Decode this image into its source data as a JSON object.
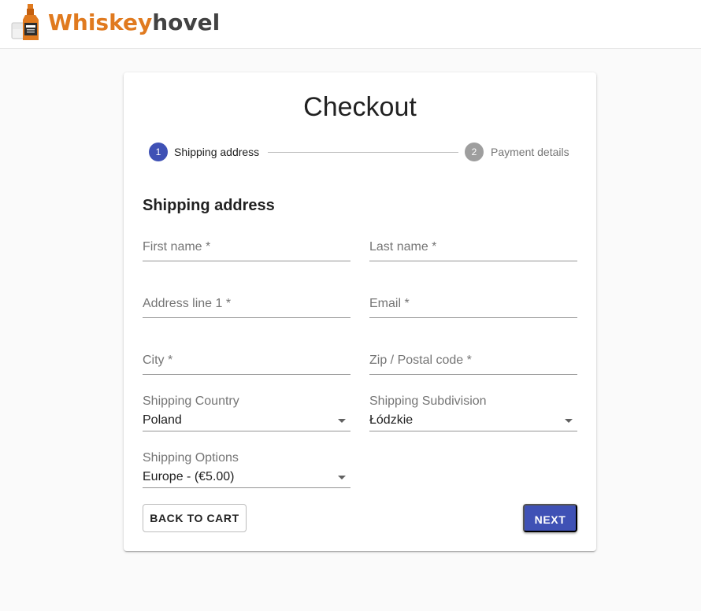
{
  "header": {
    "brand_part1": "Whiskey",
    "brand_part2": "hovel",
    "logo_icon": "whiskey-bottle-and-glass"
  },
  "checkout": {
    "title": "Checkout",
    "steps": [
      {
        "number": "1",
        "label": "Shipping address",
        "state": "active"
      },
      {
        "number": "2",
        "label": "Payment details",
        "state": "inactive"
      }
    ],
    "section_title": "Shipping address",
    "fields": {
      "first_name": {
        "placeholder": "First name *"
      },
      "last_name": {
        "placeholder": "Last name *"
      },
      "address_line1": {
        "placeholder": "Address line 1 *"
      },
      "email": {
        "placeholder": "Email *"
      },
      "city": {
        "placeholder": "City *"
      },
      "zip": {
        "placeholder": "Zip / Postal code *"
      },
      "shipping_country": {
        "label": "Shipping Country",
        "value": "Poland"
      },
      "shipping_subdivision": {
        "label": "Shipping Subdivision",
        "value": "Łódzkie"
      },
      "shipping_options": {
        "label": "Shipping Options",
        "value": "Europe - (€5.00)"
      }
    },
    "buttons": {
      "back": "BACK TO CART",
      "next": "NEXT"
    }
  },
  "colors": {
    "primary": "#3f51b5",
    "brand_orange": "#e07a1f",
    "brand_gray": "#424242",
    "inactive_step": "#9e9e9e"
  }
}
